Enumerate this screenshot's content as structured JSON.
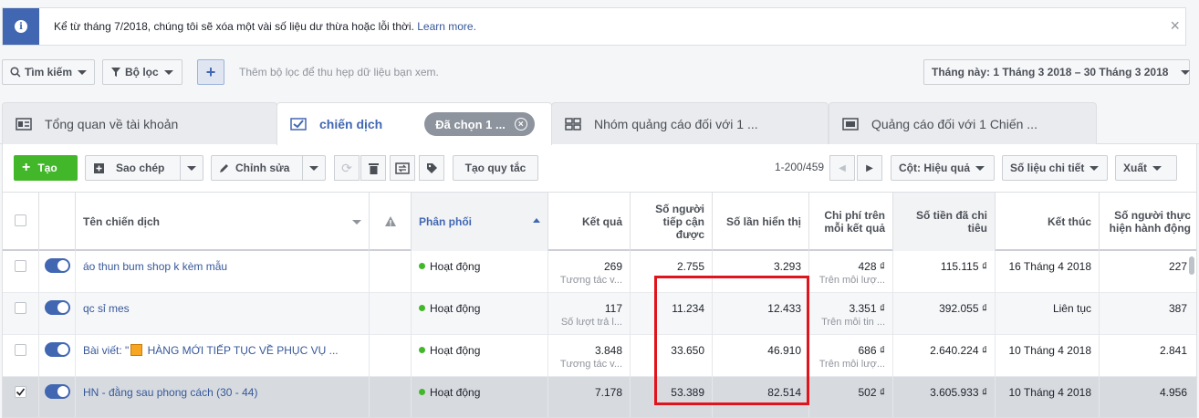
{
  "notice": {
    "message": "Kể từ tháng 7/2018, chúng tôi sẽ xóa một vài số liệu dư thừa hoặc lỗi thời.",
    "link": "Learn more."
  },
  "filters": {
    "search": "Tìm kiếm",
    "filter": "Bộ lọc",
    "add": "+",
    "hint": "Thêm bộ lọc để thu hẹp dữ liệu bạn xem.",
    "date_range": "Tháng này: 1 Tháng 3 2018 – 30 Tháng 3 2018"
  },
  "tabs": [
    {
      "label": "Tổng quan về tài khoản"
    },
    {
      "label": "chiến dịch",
      "pill": "Đã chọn 1 ..."
    },
    {
      "label": "Nhóm quảng cáo đối với 1 ..."
    },
    {
      "label": "Quảng cáo đối với 1 Chiến ..."
    }
  ],
  "toolbar": {
    "create": "Tạo",
    "copy": "Sao chép",
    "edit": "Chỉnh sửa",
    "rules": "Tạo quy tắc",
    "pager": "1-200/459",
    "columns": "Cột: Hiệu quả",
    "breakdown": "Số liệu chi tiết",
    "export": "Xuất"
  },
  "table": {
    "headers": {
      "name": "Tên chiến dịch",
      "delivery": "Phân phối",
      "results": "Kết quả",
      "reach": "Số người tiếp cận được",
      "impressions": "Số lần hiển thị",
      "cost": "Chi phí trên mỗi kết quả",
      "spent": "Số tiền đã chi tiêu",
      "ends": "Kết thúc",
      "actions": "Số người thực hiện hành động"
    },
    "rows": [
      {
        "name": "áo thun bum shop k kèm mẫu",
        "gift": false,
        "delivery": "Hoạt động",
        "results": "269",
        "results_sub": "Tương tác v...",
        "reach": "2.755",
        "impressions": "3.293",
        "cost": "428 ₫",
        "cost_sub": "Trên mỗi lượ...",
        "spent": "115.115 ₫",
        "ends": "16 Tháng 4 2018",
        "actions": "227",
        "checked": false
      },
      {
        "name": "qc sỉ mes",
        "gift": false,
        "delivery": "Hoạt động",
        "results": "117",
        "results_sub": "Số lượt trả l...",
        "reach": "11.234",
        "impressions": "12.433",
        "cost": "3.351 ₫",
        "cost_sub": "Trên mỗi tin ...",
        "spent": "392.055 ₫",
        "ends": "Liên tục",
        "actions": "387",
        "checked": false
      },
      {
        "name_prefix": "Bài viết: \"",
        "name": " HÀNG MỚI TIẾP TỤC VỀ PHỤC VỤ ...",
        "gift": true,
        "delivery": "Hoạt động",
        "results": "3.848",
        "results_sub": "Tương tác v...",
        "reach": "33.650",
        "impressions": "46.910",
        "cost": "686 ₫",
        "cost_sub": "Trên mỗi lượ...",
        "spent": "2.640.224 ₫",
        "ends": "10 Tháng 4 2018",
        "actions": "2.841",
        "checked": false
      },
      {
        "name": "HN - đằng sau phong cách (30 - 44)",
        "gift": false,
        "delivery": "Hoạt động",
        "results": "7.178",
        "results_sub": "",
        "reach": "53.389",
        "impressions": "82.514",
        "cost": "502 ₫",
        "cost_sub": "",
        "spent": "3.605.933 ₫",
        "ends": "10 Tháng 4 2018",
        "actions": "4.956",
        "checked": true
      }
    ]
  },
  "colors": {
    "accent": "#4267b2",
    "create": "#42b72a",
    "highlight": "#e0141c"
  }
}
